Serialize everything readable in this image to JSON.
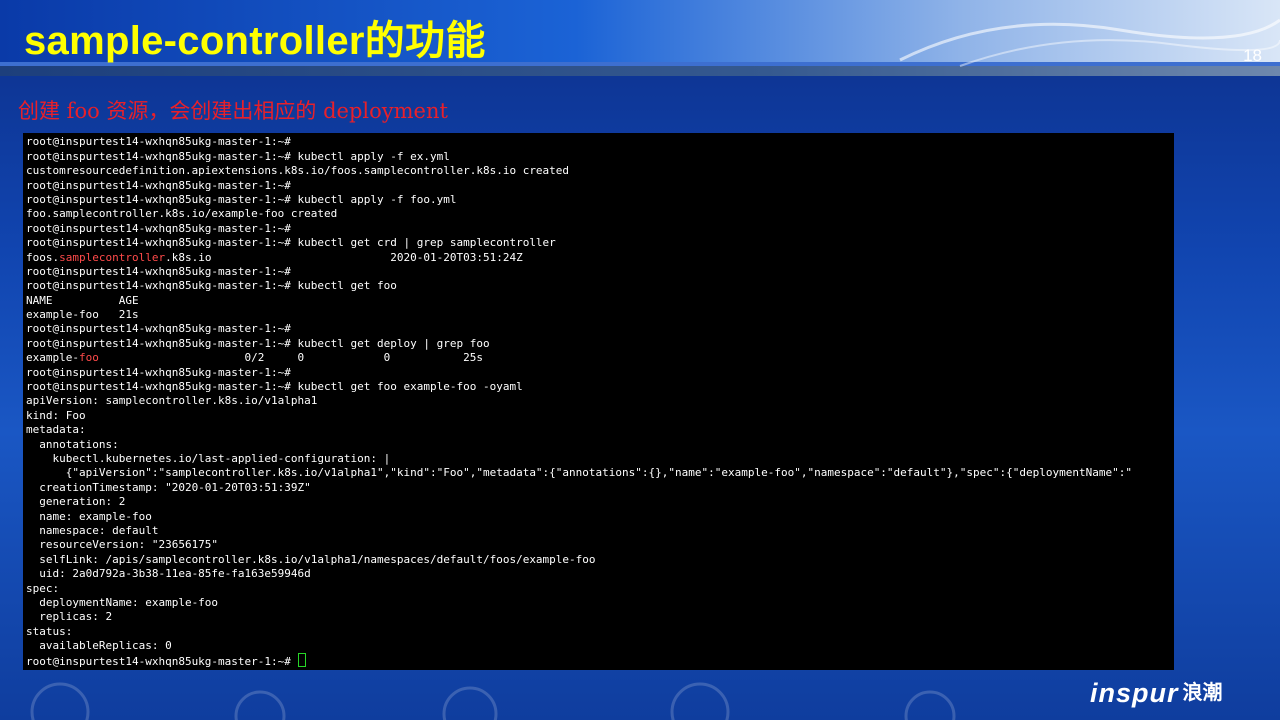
{
  "slide": {
    "title": "sample-controller的功能",
    "page_number": "18",
    "subtitle": "创建 foo 资源，会创建出相应的 deployment"
  },
  "terminal": {
    "lines": [
      {
        "text": "root@inspurtest14-wxhqn85ukg-master-1:~#"
      },
      {
        "text": "root@inspurtest14-wxhqn85ukg-master-1:~#"
      },
      {
        "text": "root@inspurtest14-wxhqn85ukg-master-1:~# kubectl apply -f ex.yml"
      },
      {
        "text": "customresourcedefinition.apiextensions.k8s.io/foos.samplecontroller.k8s.io created"
      },
      {
        "text": "root@inspurtest14-wxhqn85ukg-master-1:~#"
      },
      {
        "text": "root@inspurtest14-wxhqn85ukg-master-1:~# kubectl apply -f foo.yml"
      },
      {
        "text": "foo.samplecontroller.k8s.io/example-foo created"
      },
      {
        "text": "root@inspurtest14-wxhqn85ukg-master-1:~#"
      },
      {
        "text": "root@inspurtest14-wxhqn85ukg-master-1:~# kubectl get crd | grep samplecontroller"
      },
      {
        "pre": "foos.",
        "hl": "samplecontroller",
        "post": ".k8s.io                           2020-01-20T03:51:24Z"
      },
      {
        "text": "root@inspurtest14-wxhqn85ukg-master-1:~#"
      },
      {
        "text": "root@inspurtest14-wxhqn85ukg-master-1:~# kubectl get foo"
      },
      {
        "text": "NAME          AGE"
      },
      {
        "text": "example-foo   21s"
      },
      {
        "text": "root@inspurtest14-wxhqn85ukg-master-1:~#"
      },
      {
        "text": "root@inspurtest14-wxhqn85ukg-master-1:~# kubectl get deploy | grep foo"
      },
      {
        "pre": "example-",
        "hl": "foo",
        "post": "                      0/2     0            0           25s"
      },
      {
        "text": "root@inspurtest14-wxhqn85ukg-master-1:~#"
      },
      {
        "text": "root@inspurtest14-wxhqn85ukg-master-1:~# kubectl get foo example-foo -oyaml"
      },
      {
        "text": "apiVersion: samplecontroller.k8s.io/v1alpha1"
      },
      {
        "text": "kind: Foo"
      },
      {
        "text": "metadata:"
      },
      {
        "text": "  annotations:"
      },
      {
        "text": "    kubectl.kubernetes.io/last-applied-configuration: |"
      },
      {
        "text": "      {\"apiVersion\":\"samplecontroller.k8s.io/v1alpha1\",\"kind\":\"Foo\",\"metadata\":{\"annotations\":{},\"name\":\"example-foo\",\"namespace\":\"default\"},\"spec\":{\"deploymentName\":\""
      },
      {
        "text": "  creationTimestamp: \"2020-01-20T03:51:39Z\""
      },
      {
        "text": "  generation: 2"
      },
      {
        "text": "  name: example-foo"
      },
      {
        "text": "  namespace: default"
      },
      {
        "text": "  resourceVersion: \"23656175\""
      },
      {
        "text": "  selfLink: /apis/samplecontroller.k8s.io/v1alpha1/namespaces/default/foos/example-foo"
      },
      {
        "text": "  uid: 2a0d792a-3b38-11ea-85fe-fa163e59946d"
      },
      {
        "text": "spec:"
      },
      {
        "text": "  deploymentName: example-foo"
      },
      {
        "text": "  replicas: 2"
      },
      {
        "text": "status:"
      },
      {
        "text": "  availableReplicas: 0"
      },
      {
        "text": "root@inspurtest14-wxhqn85ukg-master-1:~# ",
        "cursor": true
      }
    ]
  },
  "logo": {
    "brand_en": "inspur",
    "brand_cn": "浪潮"
  },
  "colors": {
    "title": "#ffff00",
    "subtitle": "#e8202a",
    "highlight": "#ff4a4a",
    "cursor": "#27d627"
  }
}
